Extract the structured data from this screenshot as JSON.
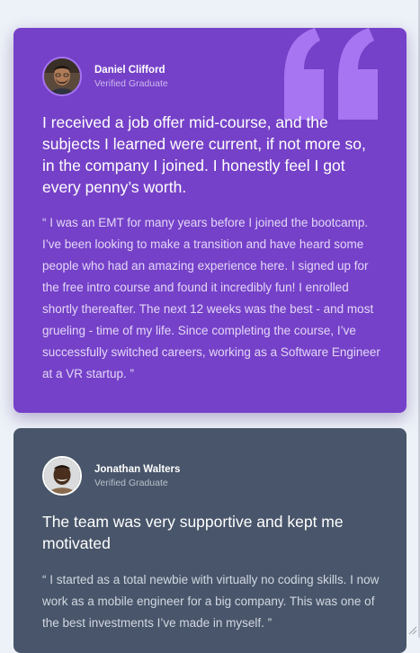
{
  "colors": {
    "page_background": "#edf2f8",
    "card_violet": "#7541c8",
    "card_slate": "#48556a",
    "quote_mark": "#a775f1"
  },
  "testimonials": [
    {
      "name": "Daniel Clifford",
      "role": "Verified Graduate",
      "headline": "I received a job offer mid-course, and the subjects I learned were current, if not more so, in the company I joined. I honestly feel I got every penny’s worth.",
      "body": "“ I was an EMT for many years before I joined the bootcamp. I’ve been looking to make a transition and have heard some people who had an amazing experience here. I signed up for the free intro course and found it incredibly fun! I enrolled shortly thereafter. The next 12 weeks was the best - and most grueling - time of my life. Since completing the course, I’ve successfully switched careers, working as a Software Engineer at a VR startup. ”",
      "avatar_icon": "avatar-photo-daniel",
      "decoration_icon": "quotation-mark-icon"
    },
    {
      "name": "Jonathan Walters",
      "role": "Verified Graduate",
      "headline": "The team was very supportive and kept me motivated",
      "body": "“ I started as a total newbie with virtually no coding skills. I now work as a mobile engineer for a big company. This was one of the best investments I’ve made in myself. ”",
      "avatar_icon": "avatar-photo-jonathan"
    }
  ]
}
